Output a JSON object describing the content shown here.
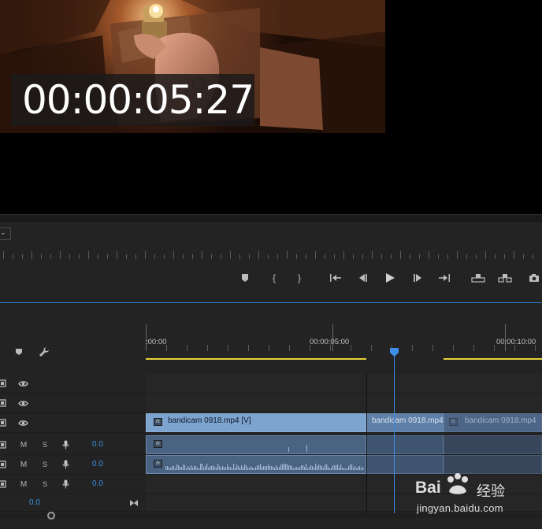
{
  "program_monitor": {
    "timecode_overlay": "00:00:05:27",
    "zoom_dropdown_icon": "chevron-down-icon"
  },
  "transport_controls": [
    {
      "name": "add-marker-button",
      "icon": "marker-icon"
    },
    {
      "name": "mark-in-button",
      "icon": "mark-in-icon",
      "glyph": "{"
    },
    {
      "name": "mark-out-button",
      "icon": "mark-out-icon",
      "glyph": "}"
    },
    {
      "name": "go-to-in-button",
      "icon": "go-to-in-icon"
    },
    {
      "name": "step-back-button",
      "icon": "step-back-icon"
    },
    {
      "name": "play-button",
      "icon": "play-icon"
    },
    {
      "name": "step-forward-button",
      "icon": "step-forward-icon"
    },
    {
      "name": "go-to-out-button",
      "icon": "go-to-out-icon"
    },
    {
      "name": "lift-button",
      "icon": "lift-icon"
    },
    {
      "name": "extract-button",
      "icon": "extract-icon"
    },
    {
      "name": "export-frame-button",
      "icon": "camera-icon"
    }
  ],
  "timeline": {
    "ruler_labels": [
      ":00:00",
      "00:00:05:00",
      "00:00:10:00"
    ],
    "video_tracks": [
      {
        "id": "V3"
      },
      {
        "id": "V2"
      },
      {
        "id": "V1",
        "clips": [
          {
            "label": "bandicam 0918.mp4 [V]"
          },
          {
            "label": "bandicam 0918.mp4"
          },
          {
            "label": "bandicam 0918.mp4"
          }
        ]
      }
    ],
    "audio_tracks": [
      {
        "id": "A1",
        "m": "M",
        "s": "S",
        "volume": "0.0"
      },
      {
        "id": "A2",
        "m": "M",
        "s": "S",
        "volume": "0.0"
      },
      {
        "id": "A3",
        "m": "M",
        "s": "S",
        "volume": "0.0"
      }
    ],
    "master_volume": "0.0",
    "clip_fx_badge": "fx",
    "playhead_color": "#3d8fe8",
    "clip_color": "#7da3cf",
    "work_area_color": "#e6d23a"
  },
  "watermark": {
    "brand": "Bai",
    "brand_cn": "经验",
    "domain": "jingyan.baidu.com"
  }
}
